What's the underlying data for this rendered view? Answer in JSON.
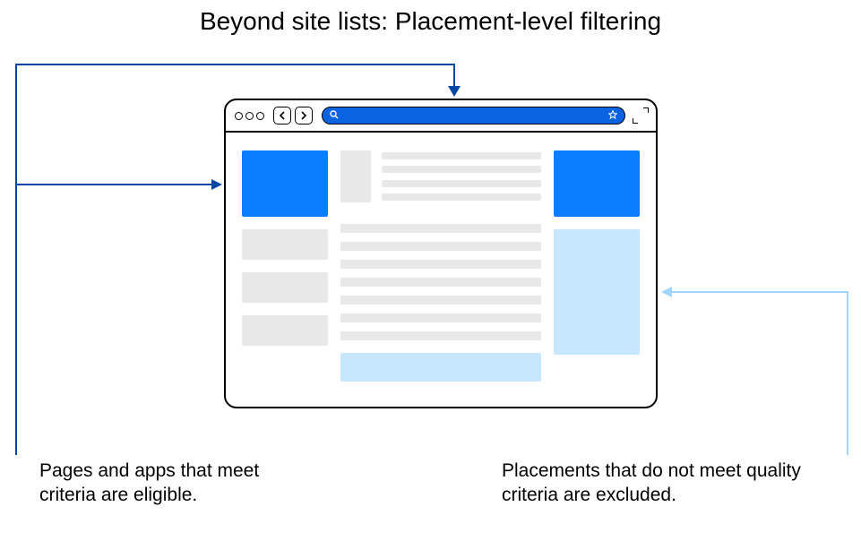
{
  "title": "Beyond site lists: Placement-level filtering",
  "captions": {
    "left": "Pages and apps that meet criteria are eligible.",
    "right": "Placements that do not meet quality criteria are excluded."
  },
  "colors": {
    "eligible": "#0a7cff",
    "excluded": "#c7e6ff",
    "placeholder": "#e8e8e8",
    "urlbar": "#0a64e1"
  }
}
